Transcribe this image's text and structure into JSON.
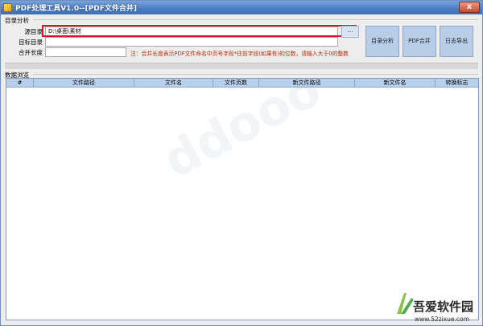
{
  "window": {
    "title": "PDF处理工具V1.0--[PDF文件合并]",
    "close_glyph": "x"
  },
  "dir_group": {
    "label": "目录分析",
    "source_dir_label": "源目录",
    "source_dir_value": "D:\\桌面\\素材",
    "target_dir_label": "目标目录",
    "target_dir_value": "",
    "merge_length_label": "合并长度",
    "merge_length_value": "",
    "browse_label": "...",
    "note": "注：合并长度表示PDF文件命名中页号字段*往前字段(如果有)的位数，请输入大于0的整数"
  },
  "buttons": {
    "analyze": "目录分析",
    "merge": "PDF合并",
    "export_log": "日志导出"
  },
  "grid": {
    "label": "数据浏览",
    "columns": [
      "#",
      "文件路径",
      "文件名",
      "文件页数",
      "新文件路径",
      "新文件名",
      "转换标志"
    ]
  },
  "brand": {
    "name": "吾爱软件园",
    "url": "www.52zixue.com"
  },
  "colors": {
    "title_bar": "#4a7cc4",
    "highlight": "#d4152a",
    "note_text": "#c02a00",
    "button_bg": "#b7cde8",
    "grid_header": "#b8d0ec"
  }
}
